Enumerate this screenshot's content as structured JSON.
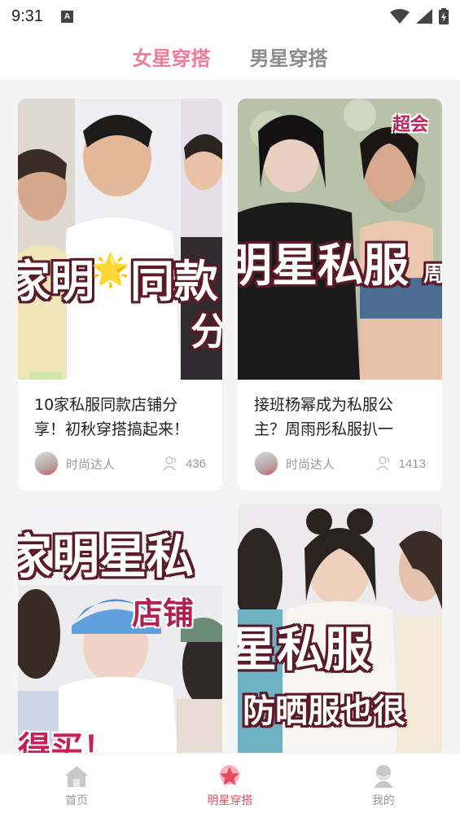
{
  "status_bar": {
    "time": "9:31",
    "notification_letter": "A"
  },
  "tabs": [
    {
      "label": "女星穿搭",
      "active": true
    },
    {
      "label": "男星穿搭",
      "active": false
    }
  ],
  "cards": [
    {
      "title": "10家私服同款店铺分享！初秋穿搭搞起来！",
      "title_line1": "10家私服同款店铺分",
      "title_line2": "享！初秋穿搭搞起来！",
      "author": "时尚达人",
      "views": "436",
      "image_text": "家明",
      "image_text2": "同款",
      "image_text3": "分",
      "image_star": "🌟"
    },
    {
      "title": "接班杨幂成为私服公主？周雨彤私服扒一",
      "title_line1": "接班杨幂成为私服公",
      "title_line2": "主？周雨彤私服扒一",
      "author": "时尚达人",
      "views": "1413",
      "image_text": "明星私服",
      "image_text2": "超会",
      "image_text3": "周"
    },
    {
      "image_text": "家明星私",
      "image_text2": "店铺",
      "image_text3": "得买！"
    },
    {
      "image_text": "星私服",
      "image_text2": "防晒服也很"
    }
  ],
  "bottom_nav": [
    {
      "label": "首页",
      "icon": "home-icon",
      "active": false
    },
    {
      "label": "明星穿搭",
      "icon": "star-icon",
      "active": true
    },
    {
      "label": "我的",
      "icon": "profile-icon",
      "active": false
    }
  ],
  "colors": {
    "accent_pink": "#f17b9b",
    "nav_active": "#e84a5f",
    "inactive_gray": "#999999"
  }
}
